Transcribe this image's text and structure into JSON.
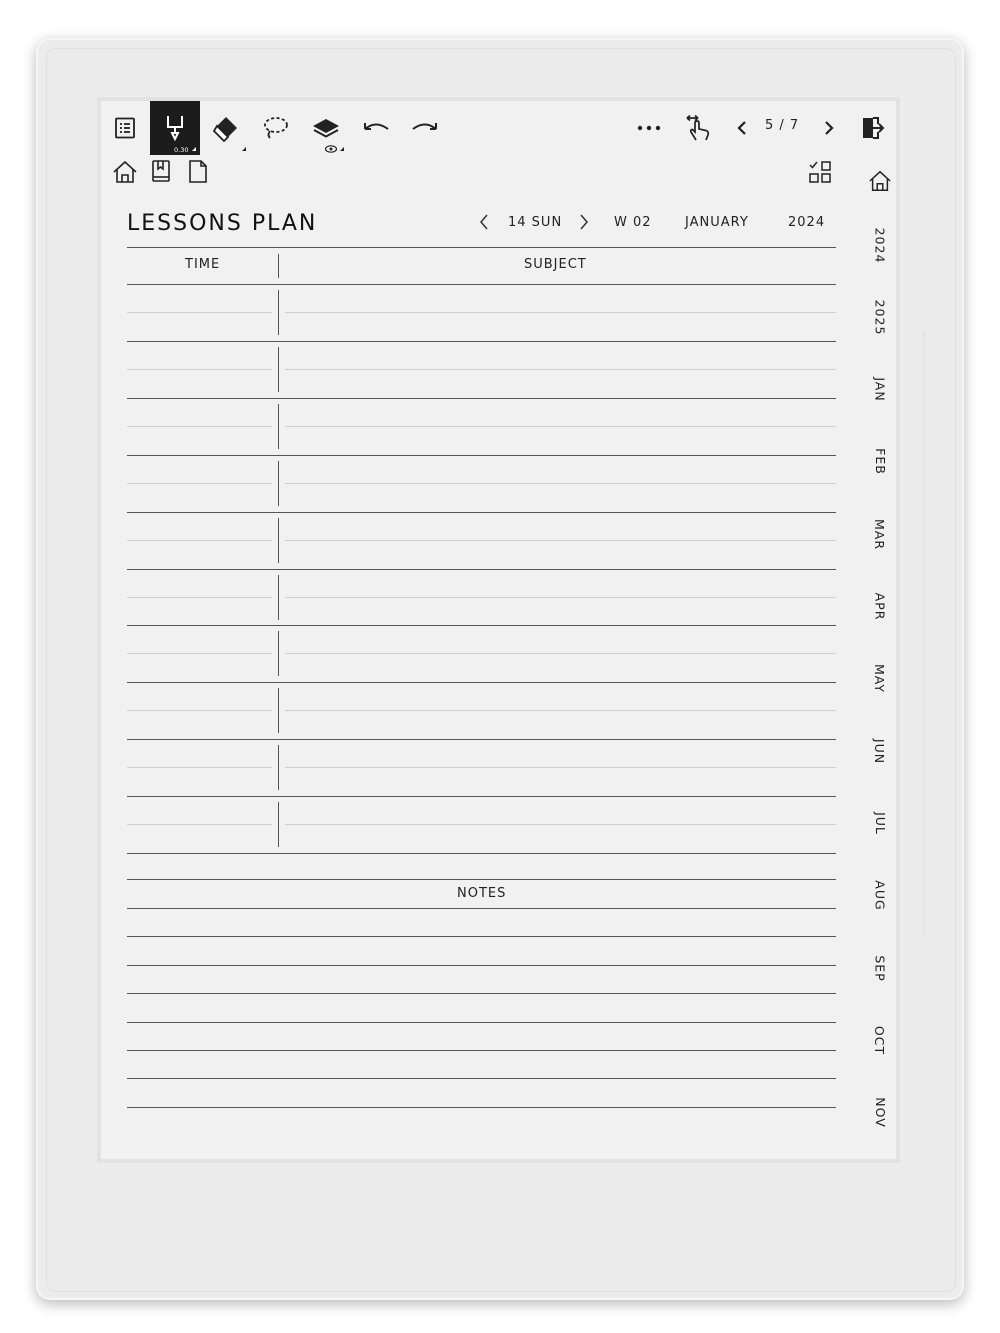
{
  "toolbar": {
    "pen_size": "0.30",
    "page_indicator": "5 / 7"
  },
  "page": {
    "title": "LESSONS PLAN",
    "day_label": "14 SUN",
    "week_label": "W 02",
    "month_label": "JANUARY",
    "year_label": "2024"
  },
  "table": {
    "time_header": "TIME",
    "subject_header": "SUBJECT",
    "row_count": 10
  },
  "notes": {
    "label": "NOTES",
    "line_count": 8
  },
  "side_tabs": [
    "2024",
    "2025",
    "JAN",
    "FEB",
    "MAR",
    "APR",
    "MAY",
    "JUN",
    "JUL",
    "AUG",
    "SEP",
    "OCT",
    "NOV"
  ],
  "icons": [
    "toc-icon",
    "pen-icon",
    "eraser-icon",
    "lasso-icon",
    "layers-icon",
    "undo-icon",
    "redo-icon",
    "more-icon",
    "swipe-gesture-icon",
    "prev-page-icon",
    "next-page-icon",
    "exit-icon",
    "home-icon",
    "bookmark-icon",
    "page-icon",
    "template-grid-icon"
  ],
  "colors": {
    "screen": "#f1f1f1",
    "ink": "#222222",
    "active_tool": "#1c1c1c"
  }
}
